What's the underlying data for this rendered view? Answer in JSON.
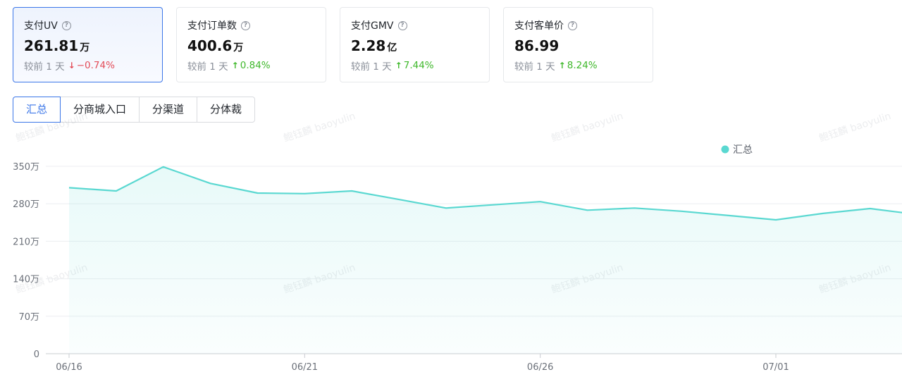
{
  "cards": [
    {
      "title": "支付UV",
      "value": "261.81",
      "unit": "万",
      "compare_label": "较前 1 天",
      "change": "−0.74%",
      "direction": "down",
      "active": true
    },
    {
      "title": "支付订单数",
      "value": "400.6",
      "unit": "万",
      "compare_label": "较前 1 天",
      "change": "0.84%",
      "direction": "up",
      "active": false
    },
    {
      "title": "支付GMV",
      "value": "2.28",
      "unit": "亿",
      "compare_label": "较前 1 天",
      "change": "7.44%",
      "direction": "up",
      "active": false
    },
    {
      "title": "支付客单价",
      "value": "86.99",
      "unit": "",
      "compare_label": "较前 1 天",
      "change": "8.24%",
      "direction": "up",
      "active": false
    }
  ],
  "tabs": [
    {
      "label": "汇总",
      "active": true
    },
    {
      "label": "分商城入口",
      "active": false
    },
    {
      "label": "分渠道",
      "active": false
    },
    {
      "label": "分体裁",
      "active": false
    }
  ],
  "watermark_text": "鲍钰麟 baoyulin",
  "colors": {
    "accent": "#3b76e8",
    "series": "#5ad8d1",
    "down": "#e34d59",
    "up": "#3fb82b"
  },
  "chart_data": {
    "type": "area",
    "series": [
      {
        "name": "汇总",
        "values": [
          310,
          304,
          349,
          318,
          300,
          299,
          304,
          288,
          272,
          278,
          284,
          268,
          272,
          266,
          258,
          250,
          262,
          271,
          260
        ]
      }
    ],
    "x": [
      "06/16",
      "06/17",
      "06/18",
      "06/19",
      "06/20",
      "06/21",
      "06/22",
      "06/23",
      "06/24",
      "06/25",
      "06/26",
      "06/27",
      "06/28",
      "06/29",
      "06/30",
      "07/01",
      "07/02",
      "07/03",
      "07/04"
    ],
    "x_tick_labels": [
      "06/16",
      "06/21",
      "06/26",
      "07/01"
    ],
    "y_tick_labels": [
      "0",
      "70万",
      "140万",
      "210万",
      "280万",
      "350万"
    ],
    "y_ticks": [
      0,
      70,
      140,
      210,
      280,
      350
    ],
    "ylim": [
      0,
      350
    ],
    "grid": true,
    "legend": "top-right"
  }
}
